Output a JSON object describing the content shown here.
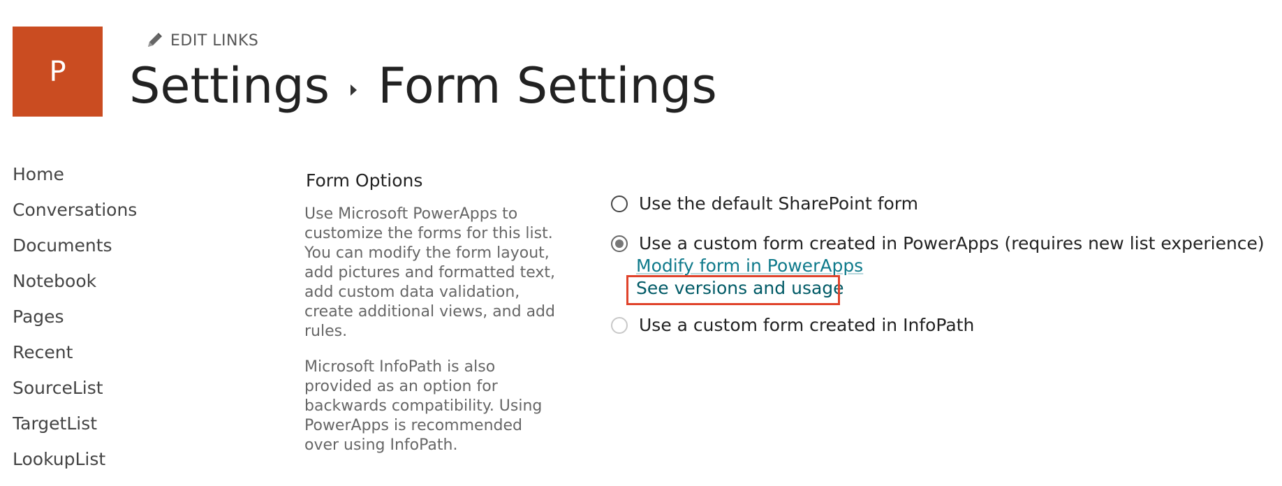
{
  "site": {
    "logo_letter": "P",
    "logo_color": "#ca4c21"
  },
  "header": {
    "edit_links_icon": "pencil-icon",
    "edit_links_label": "EDIT LINKS",
    "breadcrumb_parent": "Settings",
    "breadcrumb_separator_icon": "caret-right-icon",
    "breadcrumb_current": "Form Settings"
  },
  "nav": {
    "items": [
      {
        "label": "Home"
      },
      {
        "label": "Conversations"
      },
      {
        "label": "Documents"
      },
      {
        "label": "Notebook"
      },
      {
        "label": "Pages"
      },
      {
        "label": "Recent"
      },
      {
        "label": "SourceList"
      },
      {
        "label": "TargetList"
      },
      {
        "label": "LookupList"
      }
    ]
  },
  "form_options": {
    "title": "Form Options",
    "description_1": "Use Microsoft PowerApps to customize the forms for this list. You can modify the form layout, add pictures and formatted text, add custom data validation, create additional views, and add rules.",
    "description_2": "Microsoft InfoPath is also provided as an option for backwards compatibility. Using PowerApps is recommended over using InfoPath.",
    "options": [
      {
        "label": "Use the default SharePoint form",
        "checked": false,
        "disabled": false
      },
      {
        "label": "Use a custom form created in PowerApps (requires new list experience)",
        "checked": true,
        "disabled": false
      },
      {
        "label": "Use a custom form created in InfoPath",
        "checked": false,
        "disabled": true
      }
    ],
    "modify_link": "Modify form in PowerApps",
    "versions_link": "See versions and usage"
  },
  "colors": {
    "link": "#0f7a8b",
    "highlight": "#e0432b"
  }
}
